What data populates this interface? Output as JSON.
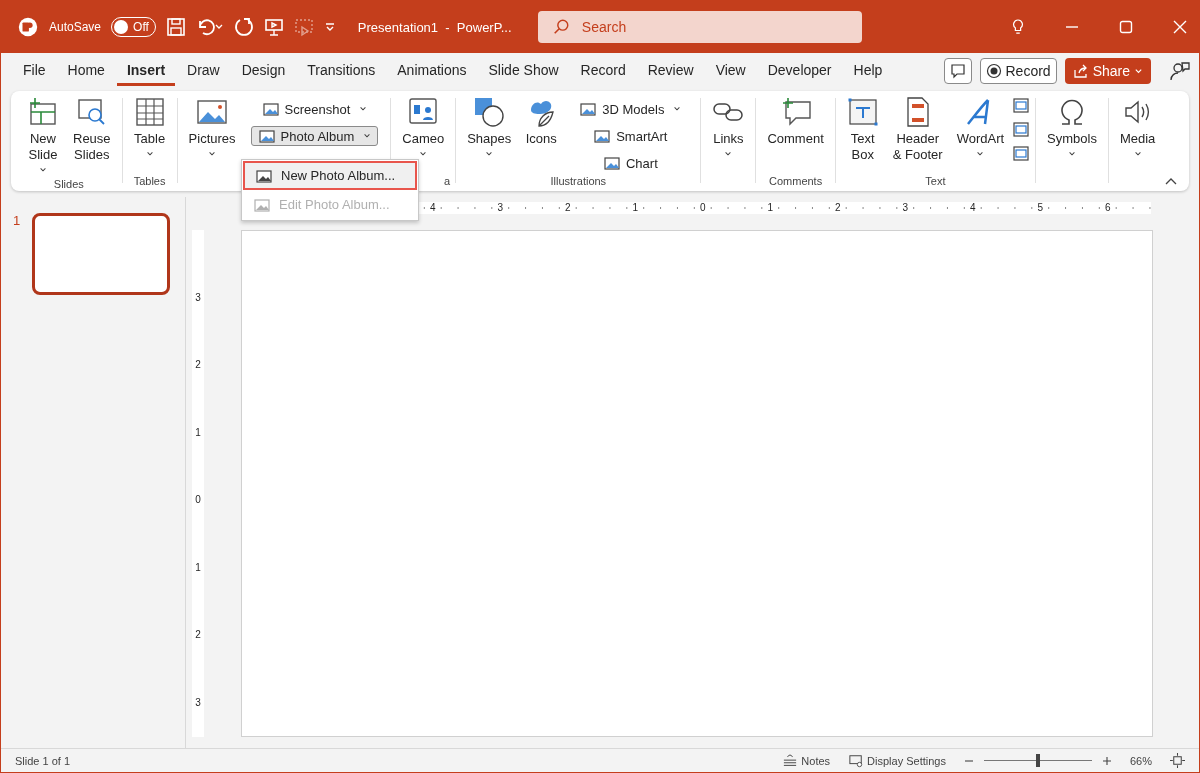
{
  "title_bar": {
    "autosave_label": "AutoSave",
    "autosave": {
      "on": false,
      "label": "Off"
    },
    "title": "Presentation1  -  PowerP...",
    "search": {
      "placeholder": "Search"
    }
  },
  "tabs": [
    {
      "label": "File",
      "selected": false
    },
    {
      "label": "Home",
      "selected": false
    },
    {
      "label": "Insert",
      "selected": true
    },
    {
      "label": "Draw",
      "selected": false
    },
    {
      "label": "Design",
      "selected": false
    },
    {
      "label": "Transitions",
      "selected": false
    },
    {
      "label": "Animations",
      "selected": false
    },
    {
      "label": "Slide Show",
      "selected": false
    },
    {
      "label": "Record",
      "selected": false
    },
    {
      "label": "Review",
      "selected": false
    },
    {
      "label": "View",
      "selected": false
    },
    {
      "label": "Developer",
      "selected": false
    },
    {
      "label": "Help",
      "selected": false
    }
  ],
  "record_button": "Record",
  "share_button": "Share",
  "ribbon": {
    "groups": [
      {
        "label": "Slides",
        "columns": [
          [
            {
              "kind": "large",
              "label": "New\nSlide",
              "dropdown": true
            }
          ],
          [
            {
              "kind": "large",
              "label": "Reuse\nSlides",
              "dropdown": false
            }
          ]
        ]
      },
      {
        "label": "Tables",
        "columns": [
          [
            {
              "kind": "large",
              "label": "Table",
              "dropdown": true
            }
          ]
        ]
      },
      {
        "columns": [
          [
            {
              "kind": "large",
              "label": "Pictures",
              "dropdown": true
            }
          ],
          [
            {
              "kind": "small",
              "label": "Screenshot",
              "dropdown": true,
              "pressed": false
            },
            {
              "kind": "small",
              "label": "Photo Album",
              "dropdown": true,
              "pressed": true
            }
          ]
        ]
      },
      {
        "label": "a",
        "columns": [
          [
            {
              "kind": "large",
              "label": "Cameo",
              "dropdown": true
            }
          ]
        ]
      },
      {
        "label": "Illustrations",
        "columns": [
          [
            {
              "kind": "large",
              "label": "Shapes",
              "dropdown": true
            }
          ],
          [
            {
              "kind": "large",
              "label": "Icons",
              "dropdown": false
            }
          ],
          [
            {
              "kind": "small",
              "label": "3D Models",
              "dropdown": true,
              "pressed": false
            },
            {
              "kind": "small",
              "label": "SmartArt",
              "dropdown": false,
              "pressed": false
            },
            {
              "kind": "small",
              "label": "Chart",
              "dropdown": false,
              "pressed": false
            }
          ]
        ]
      },
      {
        "columns": [
          [
            {
              "kind": "large",
              "label": "Links",
              "dropdown": true
            }
          ]
        ]
      },
      {
        "label": "Comments",
        "columns": [
          [
            {
              "kind": "large",
              "label": "Comment",
              "dropdown": false
            }
          ]
        ]
      },
      {
        "label": "Text",
        "columns": [
          [
            {
              "kind": "large",
              "label": "Text\nBox",
              "dropdown": false
            }
          ],
          [
            {
              "kind": "large",
              "label": "Header\n& Footer",
              "dropdown": false
            }
          ],
          [
            {
              "kind": "large",
              "label": "WordArt",
              "dropdown": true
            }
          ],
          [
            {
              "kind": "icon"
            },
            {
              "kind": "icon"
            },
            {
              "kind": "icon"
            }
          ]
        ]
      },
      {
        "columns": [
          [
            {
              "kind": "large",
              "label": "Symbols",
              "dropdown": true
            }
          ]
        ]
      },
      {
        "columns": [
          [
            {
              "kind": "large",
              "label": "Media",
              "dropdown": true
            }
          ]
        ]
      }
    ]
  },
  "photo_album_menu": [
    {
      "label": "New Photo Album...",
      "disabled": false,
      "highlighted": true
    },
    {
      "label": "Edit Photo Album...",
      "disabled": true,
      "highlighted": false
    }
  ],
  "slides": [
    {
      "number": "1",
      "selected": true
    }
  ],
  "horizontal_ruler": [
    "4",
    "3",
    "2",
    "1",
    "0",
    "1",
    "2",
    "3",
    "4",
    "5",
    "6"
  ],
  "vertical_ruler": [
    "3",
    "2",
    "1",
    "0",
    "1",
    "2",
    "3"
  ],
  "status_bar": {
    "slide_count": "Slide 1 of 1",
    "notes": "Notes",
    "display_settings": "Display Settings",
    "zoom": {
      "level": 0.5
    },
    "zoom_percent": "66%"
  }
}
